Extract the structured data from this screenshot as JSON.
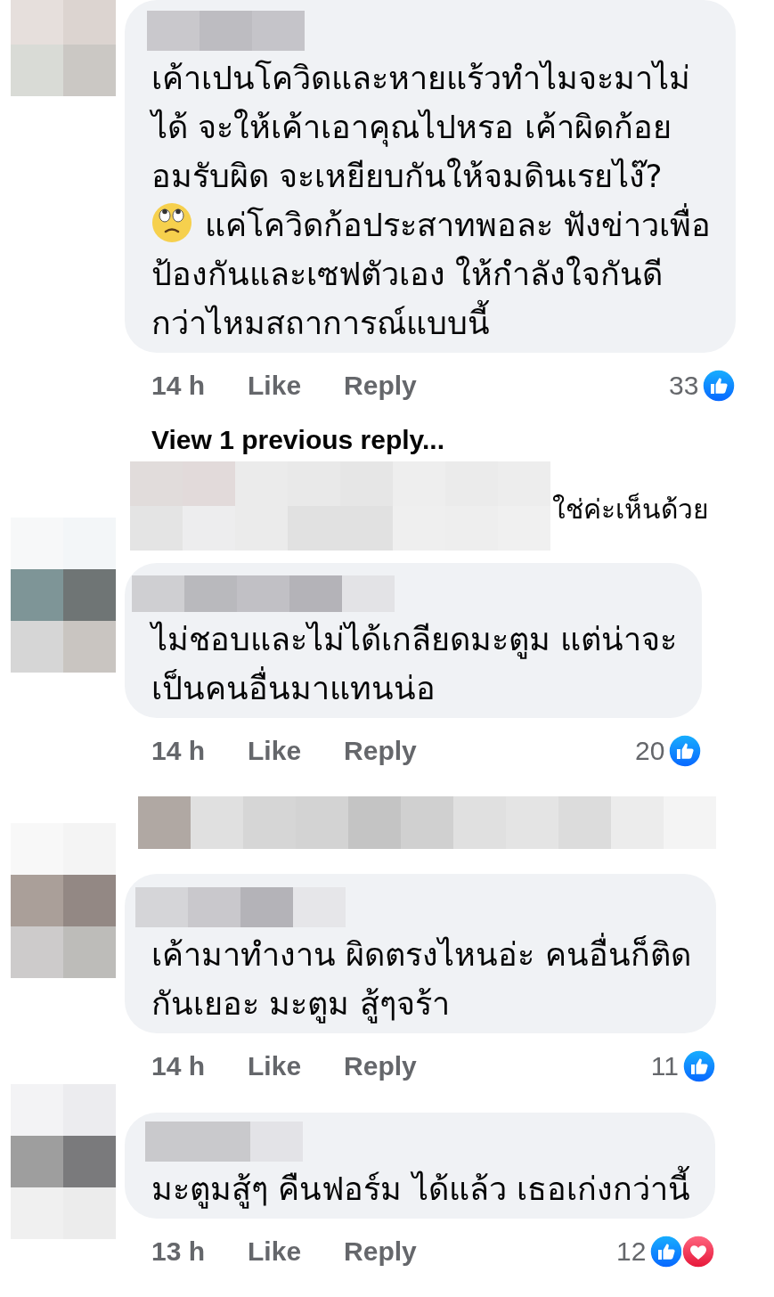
{
  "items": [
    {
      "kind": "comment",
      "segments": [
        {
          "kind": "text",
          "text": "เค้าเปนโควิดและหายแร้วทำไมจะมาไม่\nได้ จะให้เค้าเอาคุณไปหรอ เค้าผิดก้อย\nอมรับผิด จะเหยียบกันให้จมดินเรยไง๊?"
        },
        {
          "kind": "emoji"
        },
        {
          "kind": "text",
          "text": "แค่โควิดก้อประสาทพอละ ฟังข่าวเพื่อ"
        },
        {
          "kind": "text",
          "text": "ป้องกันและเซฟตัวเอง ให้กำลังใจกันดี\nกว่าไหมสถาการณ์แบบนี้"
        }
      ],
      "time": "14 h",
      "actions": [
        "Like",
        "Reply"
      ],
      "count": "33",
      "reactions": [
        {
          "kind": "like"
        }
      ]
    },
    {
      "kind": "link",
      "text": "View 1 previous reply..."
    },
    {
      "kind": "hidden_reply",
      "text": "ใช่ค่ะเห็นด้วย"
    },
    {
      "kind": "comment",
      "segments": [
        {
          "kind": "text",
          "text": "ไม่ชอบและไม่ได้เกลียดมะตูม แต่น่าจะ\nเป็นคนอื่นมาแทนน่อ"
        }
      ],
      "time": "14 h",
      "actions": [
        "Like",
        "Reply"
      ],
      "count": "20",
      "reactions": [
        {
          "kind": "like"
        }
      ]
    },
    {
      "kind": "redacted"
    },
    {
      "kind": "comment",
      "segments": [
        {
          "kind": "text",
          "text": "เค้ามาทำงาน ผิดตรงไหนอ่ะ คนอื่นก็ติด\nกันเยอะ มะตูม สู้ๆจร้า"
        }
      ],
      "time": "14 h",
      "actions": [
        "Like",
        "Reply"
      ],
      "count": "11",
      "reactions": [
        {
          "kind": "like"
        }
      ]
    },
    {
      "kind": "comment",
      "segments": [
        {
          "kind": "text",
          "text": "มะตูมสู้ๆ คืนฟอร์ม ได้แล้ว เธอเก่งกว่านี้"
        }
      ],
      "time": "13 h",
      "actions": [
        "Like",
        "Reply"
      ],
      "count": "12",
      "reactions": [
        {
          "kind": "like"
        },
        {
          "kind": "love"
        }
      ]
    }
  ]
}
